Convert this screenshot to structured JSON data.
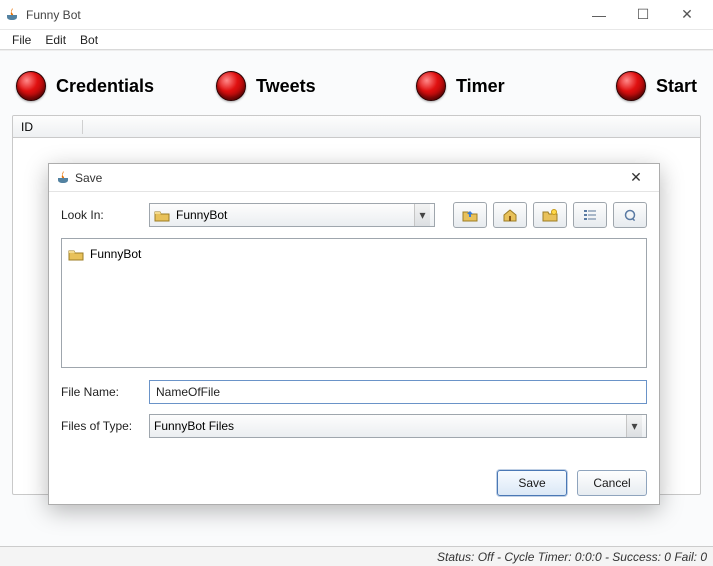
{
  "window": {
    "title": "Funny Bot"
  },
  "menu": {
    "items": [
      "File",
      "Edit",
      "Bot"
    ]
  },
  "tabs": {
    "items": [
      {
        "label": "Credentials"
      },
      {
        "label": "Tweets"
      },
      {
        "label": "Timer"
      },
      {
        "label": "Start"
      }
    ]
  },
  "table": {
    "columns": [
      "ID"
    ]
  },
  "dialog": {
    "title": "Save",
    "look_in_label": "Look In:",
    "look_in_value": "FunnyBot",
    "toolbar_icons": [
      "up-folder-icon",
      "home-icon",
      "new-folder-icon",
      "list-view-icon",
      "details-view-icon"
    ],
    "listing": [
      {
        "name": "FunnyBot",
        "type": "folder"
      }
    ],
    "filename_label": "File Name:",
    "filename_value": "NameOfFile",
    "filetype_label": "Files of Type:",
    "filetype_value": "FunnyBot Files",
    "save_label": "Save",
    "cancel_label": "Cancel"
  },
  "status": {
    "text": "Status: Off - Cycle Timer: 0:0:0 - Success: 0 Fail: 0"
  }
}
